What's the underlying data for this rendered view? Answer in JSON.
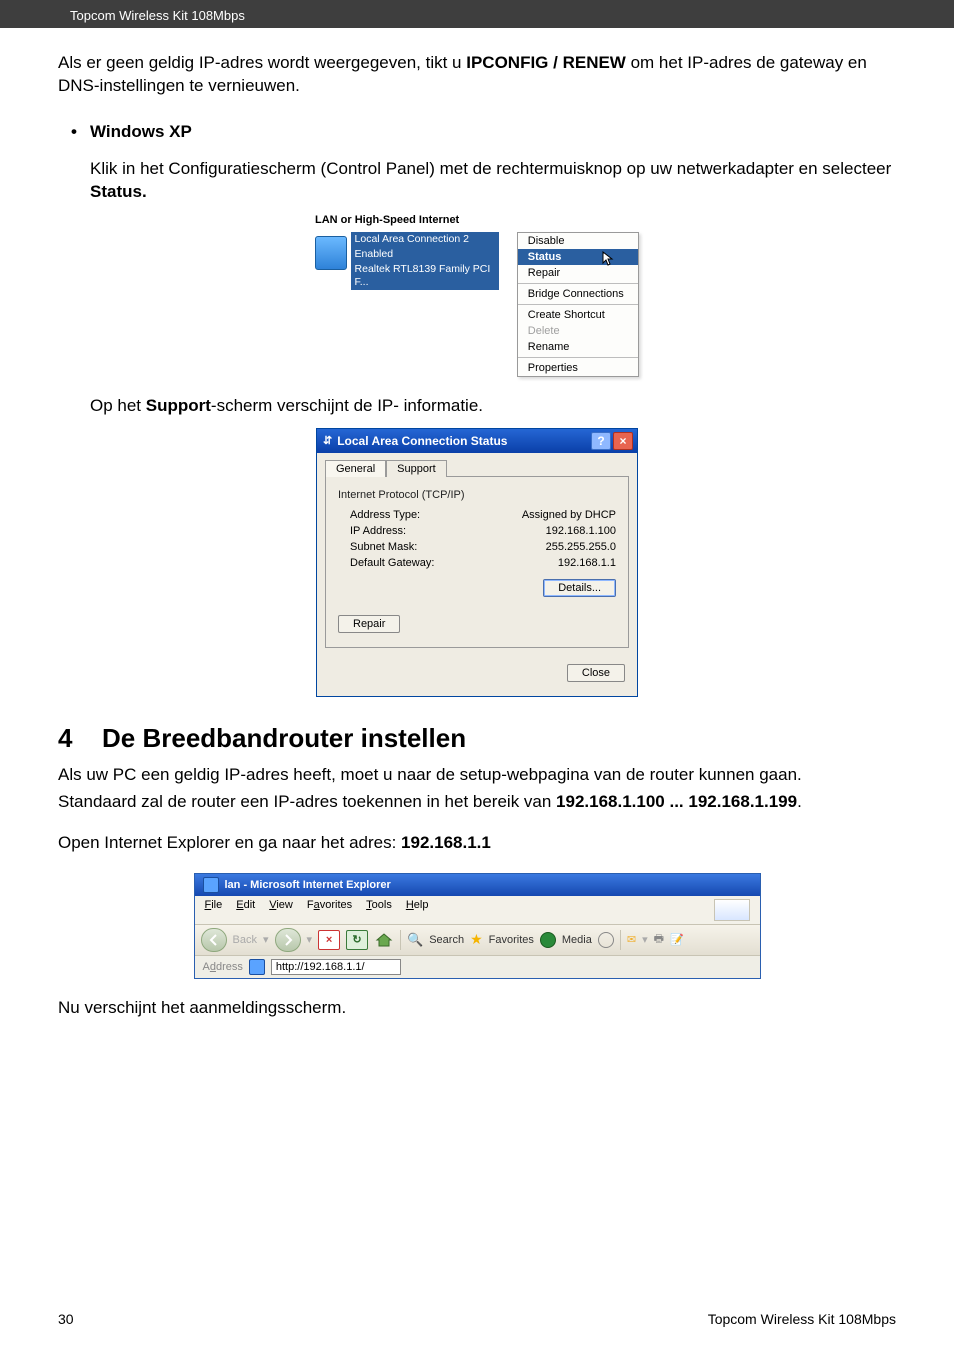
{
  "header": {
    "product": "Topcom Wireless Kit 108Mbps"
  },
  "intro": {
    "text_a": "Als er geen geldig IP-adres wordt weergegeven, tikt u ",
    "cmd": "IPCONFIG / RENEW",
    "text_b": " om het IP-adres de gateway en DNS-instellingen te vernieuwen."
  },
  "bullet": {
    "label": "Windows XP"
  },
  "step1": {
    "text_a": "Klik in het Configuratiescherm (Control Panel) met de rechtermuisknop op uw netwerkadapter en selecteer ",
    "bold": "Status."
  },
  "shot1": {
    "section_title": "LAN or High-Speed Internet",
    "conn_name": "Local Area Connection 2",
    "conn_state": "Enabled",
    "conn_adapter": "Realtek RTL8139 Family PCI F...",
    "menu": {
      "disable": "Disable",
      "status": "Status",
      "repair": "Repair",
      "bridge": "Bridge Connections",
      "shortcut": "Create Shortcut",
      "delete": "Delete",
      "rename": "Rename",
      "properties": "Properties"
    }
  },
  "step2": {
    "text_a": "Op het ",
    "bold": "Support",
    "text_b": "-scherm verschijnt de IP- informatie."
  },
  "dlg": {
    "title": "Local Area Connection Status",
    "tab_general": "General",
    "tab_support": "Support",
    "group": "Internet Protocol (TCP/IP)",
    "rows": {
      "addr_type_l": "Address Type:",
      "addr_type_v": "Assigned by DHCP",
      "ip_l": "IP Address:",
      "ip_v": "192.168.1.100",
      "mask_l": "Subnet Mask:",
      "mask_v": "255.255.255.0",
      "gw_l": "Default Gateway:",
      "gw_v": "192.168.1.1"
    },
    "details_btn": "Details...",
    "repair_btn": "Repair",
    "close_btn": "Close"
  },
  "section4": {
    "num": "4",
    "title": "De Breedbandrouter instellen"
  },
  "sec4_p1": "Als uw PC een geldig IP-adres heeft, moet u naar de setup-webpagina van de router kunnen gaan.",
  "sec4_p2_a": "Standaard zal de router een IP-adres toekennen in het bereik van ",
  "sec4_p2_b": "192.168.1.100 ... 192.168.1.199",
  "sec4_p2_c": ".",
  "sec4_p3_a": "Open Internet Explorer en ga naar het adres: ",
  "sec4_p3_b": "192.168.1.1",
  "ie": {
    "title": "lan - Microsoft Internet Explorer",
    "menu": {
      "file": "File",
      "edit": "Edit",
      "view": "View",
      "fav": "Favorites",
      "tools": "Tools",
      "help": "Help"
    },
    "toolbar": {
      "back": "Back",
      "search": "Search",
      "favorites": "Favorites",
      "media": "Media"
    },
    "addr_label": "Address",
    "url": "http://192.168.1.1/"
  },
  "after_ie": "Nu verschijnt het aanmeldingsscherm.",
  "footer": {
    "page": "30",
    "product": "Topcom Wireless Kit 108Mbps"
  }
}
